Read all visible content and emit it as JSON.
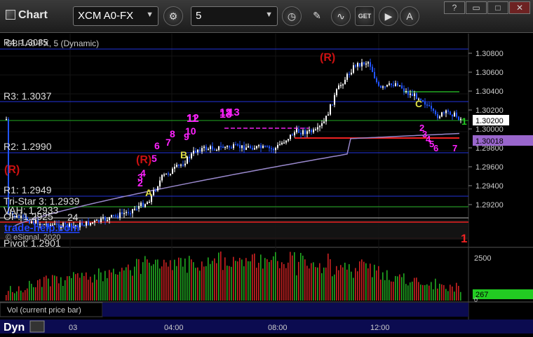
{
  "toolbar": {
    "app_title": "Chart",
    "symbol": "XCM A0-FX",
    "interval": "5"
  },
  "chart": {
    "title": "GBP A0-FX, 5 (Dynamic)",
    "copyright": "© eSignal, 2020",
    "overlay_link": "trade-help.com",
    "volume_label": "Vol (current price bar)",
    "dyn_label": "Dyn",
    "price_axis": [
      "1.30800",
      "1.30600",
      "1.30400",
      "1.30200",
      "1.30000",
      "1.29800",
      "1.29600",
      "1.29400",
      "1.29200"
    ],
    "current_price": "1.30200",
    "ma_price": "1.30018",
    "volume_axis": [
      "2500",
      "267",
      "0"
    ],
    "time_axis": [
      "03",
      "04:00",
      "08:00",
      "12:00"
    ],
    "levels": [
      {
        "label": "R4: 1.3085",
        "color": "#2244ff"
      },
      {
        "label": "R3: 1.3037",
        "color": "#2244ff"
      },
      {
        "label": "R2: 1.2990",
        "color": "#2244ff"
      },
      {
        "label": "R1: 1.2949",
        "color": "#2244ff"
      },
      {
        "label": "Tri-Star 3: 1.2939",
        "color": "#22aa22"
      },
      {
        "label": "OP: 1.2925",
        "color": "#ffffff"
      },
      {
        "label": "Pivot: 1.2901",
        "color": "#ff2222"
      }
    ],
    "obscured_labels": [
      "VAH: 1.2933",
      "24"
    ],
    "markers": {
      "magenta": [
        "2",
        "3",
        "4",
        "5",
        "6",
        "7",
        "8",
        "9",
        "10",
        "11",
        "12",
        "13",
        "1",
        "2",
        "3",
        "4",
        "5",
        "6",
        "7"
      ],
      "red": [
        "(R)",
        "(R)",
        "(R)",
        "1"
      ],
      "yellow": [
        "A",
        "B",
        "C"
      ],
      "green": [
        "1"
      ]
    },
    "colors": {
      "background": "#000000",
      "candle_up": "#ffffff",
      "candle_down": "#2255ff",
      "ma_line": "#9988cc",
      "grid": "#1a1a1a",
      "volume_up": "#22aa22",
      "volume_down": "#cc2222"
    }
  }
}
